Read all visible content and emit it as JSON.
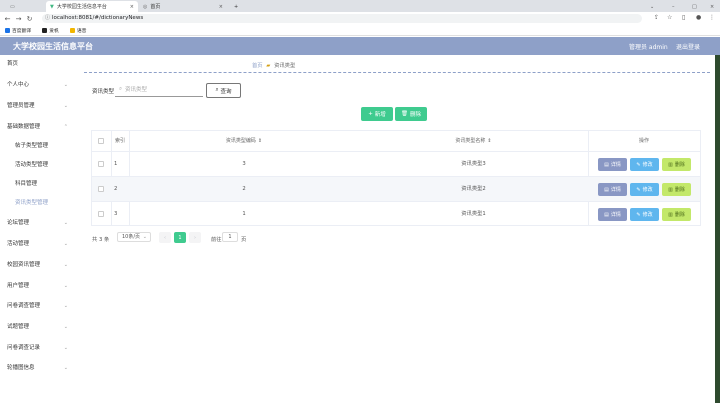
{
  "browser": {
    "tabs": [
      {
        "label": ""
      },
      {
        "label": "大学校园生活信息平台"
      },
      {
        "label": "首页"
      }
    ],
    "url": "localhost:8081/#/dictionaryNews",
    "bookmarks": [
      "百度翻译",
      "爱帆",
      "语音"
    ]
  },
  "header": {
    "title": "大学校园生活信息平台",
    "user": "管理员 admin",
    "logout": "退出登录",
    "color": "#8ea0c8"
  },
  "sidebar": {
    "items": [
      {
        "label": "首页"
      },
      {
        "label": "个人中心"
      },
      {
        "label": "管理员管理"
      },
      {
        "label": "基础数据管理"
      },
      {
        "label": "帖子类型管理"
      },
      {
        "label": "活动类型管理"
      },
      {
        "label": "科目管理"
      },
      {
        "label": "资讯类型管理"
      },
      {
        "label": "论坛管理"
      },
      {
        "label": "活动管理"
      },
      {
        "label": "校园资讯管理"
      },
      {
        "label": "用户管理"
      },
      {
        "label": "问卷调查管理"
      },
      {
        "label": "试题管理"
      },
      {
        "label": "问卷调查记录"
      },
      {
        "label": "轮播图信息"
      }
    ]
  },
  "breadcrumb": {
    "home": "首页",
    "current": "资讯类型"
  },
  "search": {
    "label": "资讯类型",
    "placeholder": "资讯类型",
    "button": "查询"
  },
  "actions": {
    "add": "新增",
    "delete": "删除"
  },
  "table": {
    "headers": {
      "index": "索引",
      "code": "资讯类型编码",
      "name": "资讯类型名称",
      "ops": "操作"
    },
    "rows": [
      {
        "index": "1",
        "code": "3",
        "name": "资讯类型3"
      },
      {
        "index": "2",
        "code": "2",
        "name": "资讯类型2"
      },
      {
        "index": "3",
        "code": "1",
        "name": "资讯类型1"
      }
    ],
    "op_labels": {
      "detail": "详情",
      "edit": "修改",
      "delete": "删除"
    }
  },
  "pagination": {
    "total": "共 3 条",
    "page_size": "10条/页",
    "current": "1",
    "goto_label": "前往",
    "goto_value": "1",
    "page_suffix": "页"
  }
}
